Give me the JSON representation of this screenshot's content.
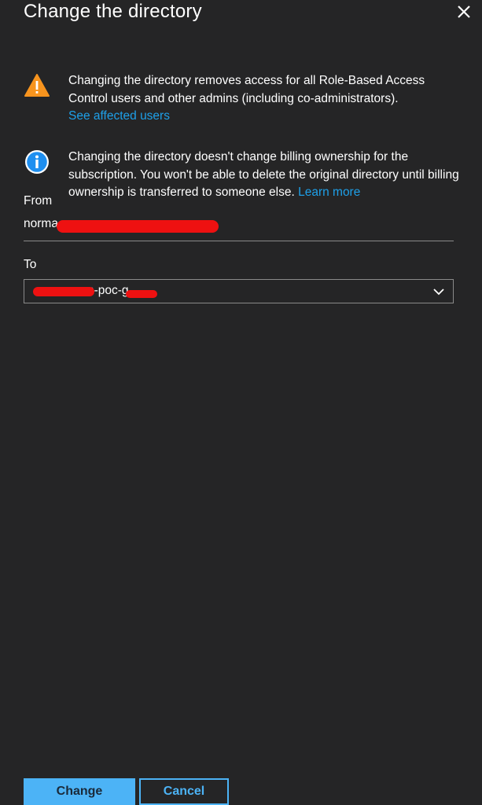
{
  "panel": {
    "title": "Change the directory",
    "close_icon": "close-icon"
  },
  "warning": {
    "icon": "warning-icon",
    "text": "Changing the directory removes access for all Role-Based Access Control users and other admins (including co-administrators).",
    "link": "See affected users"
  },
  "info": {
    "icon": "info-icon",
    "text": "Changing the directory doesn't change billing ownership for the subscription. You won't be able to delete the original directory until billing ownership is transferred to someone else.",
    "link": "Learn more"
  },
  "from": {
    "label": "From",
    "value_visible": "norma"
  },
  "to": {
    "label": "To",
    "value_visible": "n-poc-g",
    "chevron_icon": "chevron-down-icon"
  },
  "buttons": {
    "change": "Change",
    "cancel": "Cancel"
  },
  "colors": {
    "background": "#252526",
    "link": "#1ea0e9",
    "primary_button": "#4cb3f6",
    "warning": "#f7941e",
    "info": "#1e8ff0",
    "redaction": "#ee1111"
  }
}
